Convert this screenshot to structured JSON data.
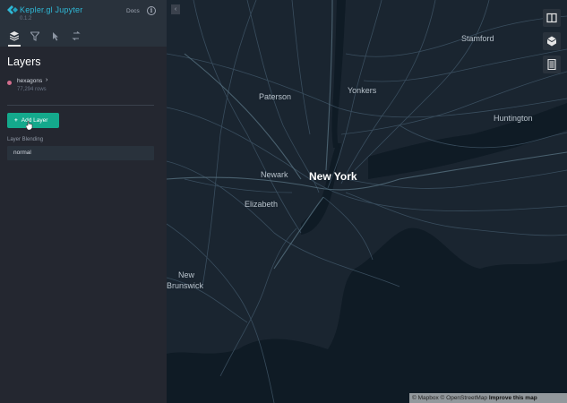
{
  "header": {
    "app_name": "Kepler.gl Jupyter",
    "version": "0.1.2",
    "docs_label": "Docs",
    "info_glyph": "i",
    "logo_icon": "kepler-logo-icon"
  },
  "tabs": [
    {
      "name": "layers-tab",
      "icon": "layers-icon",
      "active": true
    },
    {
      "name": "filters-tab",
      "icon": "filter-icon",
      "active": false
    },
    {
      "name": "interactions-tab",
      "icon": "cursor-click-icon",
      "active": false
    },
    {
      "name": "basemap-tab",
      "icon": "map-settings-icon",
      "active": false
    }
  ],
  "panel": {
    "title": "Layers",
    "dataset": {
      "name": "hexagons",
      "rows": "77,294 rows",
      "color": "#d26d8d"
    },
    "add_layer_label": "Add Layer",
    "layer_blending_label": "Layer Blending",
    "layer_blending_value": "normal"
  },
  "map": {
    "collapse_glyph": "‹",
    "labels": {
      "stamford": "Stamford",
      "paterson": "Paterson",
      "yonkers": "Yonkers",
      "huntington": "Huntington",
      "newark": "Newark",
      "new_york": "New York",
      "elizabeth": "Elizabeth",
      "new_brunswick_1": "New",
      "new_brunswick_2": "Brunswick"
    },
    "controls": [
      "split-map-icon",
      "3d-view-icon",
      "legend-icon"
    ],
    "attribution": {
      "mapbox": "© Mapbox",
      "osm": "© OpenStreetMap",
      "improve": "Improve this map"
    }
  },
  "colors": {
    "panel_bg": "#242730",
    "header_bg": "#29323c",
    "accent": "#14a98c",
    "brand": "#2fb8d6",
    "map_land": "#1a2530",
    "map_water": "#0f1b25"
  }
}
